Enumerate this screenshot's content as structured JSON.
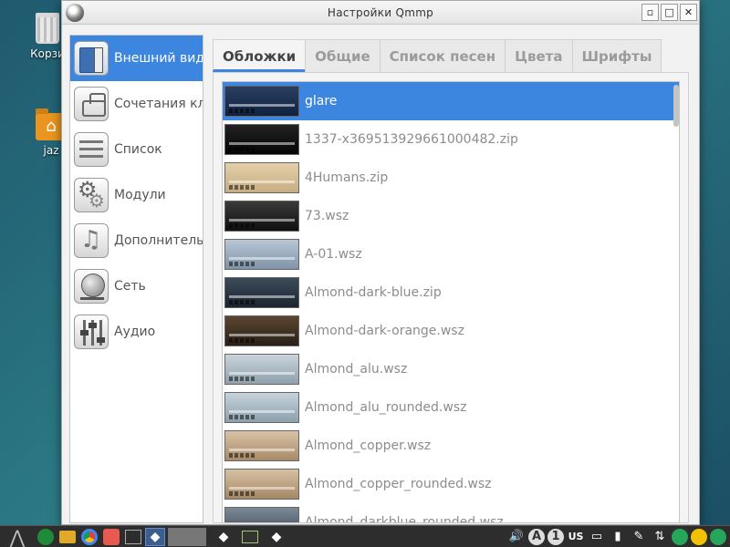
{
  "desktop": {
    "icons": [
      {
        "label": "Корзи",
        "icon": "trash-icon"
      },
      {
        "label": "jaz",
        "icon": "home-folder-icon"
      }
    ]
  },
  "window": {
    "title": "Настройки Qmmp",
    "buttons": {
      "minimize": "▫",
      "maximize": "□",
      "close": "✕"
    }
  },
  "sidebar": {
    "items": [
      {
        "label": "Внешний вид",
        "icon": "appearance-icon",
        "active": true
      },
      {
        "label": "Сочетания клавиш",
        "icon": "shortcuts-icon",
        "active": false
      },
      {
        "label": "Список",
        "icon": "playlist-icon",
        "active": false
      },
      {
        "label": "Модули",
        "icon": "plugins-icon",
        "active": false
      },
      {
        "label": "Дополнительно",
        "icon": "advanced-icon",
        "active": false
      },
      {
        "label": "Сеть",
        "icon": "network-icon",
        "active": false
      },
      {
        "label": "Аудио",
        "icon": "audio-icon",
        "active": false
      }
    ]
  },
  "tabs": [
    {
      "label": "Обложки",
      "active": true
    },
    {
      "label": "Общие",
      "active": false
    },
    {
      "label": "Список песен",
      "active": false
    },
    {
      "label": "Цвета",
      "active": false
    },
    {
      "label": "Шрифты",
      "active": false
    }
  ],
  "skins": [
    {
      "name": "glare",
      "selected": true,
      "thumb_colors": [
        "#2a3f63",
        "#112240"
      ]
    },
    {
      "name": "1337-x369513929661000482.zip",
      "selected": false,
      "thumb_colors": [
        "#222222",
        "#050505"
      ]
    },
    {
      "name": "4Humans.zip",
      "selected": false,
      "thumb_colors": [
        "#e3cfa8",
        "#c7ad82"
      ]
    },
    {
      "name": "73.wsz",
      "selected": false,
      "thumb_colors": [
        "#3a3a3a",
        "#101010"
      ]
    },
    {
      "name": "A-01.wsz",
      "selected": false,
      "thumb_colors": [
        "#b9c7d6",
        "#7f93a8"
      ]
    },
    {
      "name": "Almond-dark-blue.zip",
      "selected": false,
      "thumb_colors": [
        "#3d4c5a",
        "#1a2430"
      ]
    },
    {
      "name": "Almond-dark-orange.wsz",
      "selected": false,
      "thumb_colors": [
        "#5a4630",
        "#2a2018"
      ]
    },
    {
      "name": "Almond_alu.wsz",
      "selected": false,
      "thumb_colors": [
        "#c9d4db",
        "#8fa1ad"
      ]
    },
    {
      "name": "Almond_alu_rounded.wsz",
      "selected": false,
      "thumb_colors": [
        "#c6d3db",
        "#8ca0ad"
      ]
    },
    {
      "name": "Almond_copper.wsz",
      "selected": false,
      "thumb_colors": [
        "#d8c2a6",
        "#a88a68"
      ]
    },
    {
      "name": "Almond_copper_rounded.wsz",
      "selected": false,
      "thumb_colors": [
        "#d6c0a3",
        "#a68865"
      ]
    },
    {
      "name": "Almond_darkblue_rounded.wsz",
      "selected": false,
      "thumb_colors": [
        "#7c8a98",
        "#3b4652"
      ]
    }
  ],
  "taskbar": {
    "launchers": [
      "lxde-menu-icon",
      "terminal-icon",
      "file-manager-icon",
      "chrome-icon",
      "paint-icon",
      "show-desktop-icon"
    ],
    "tray": {
      "volume": "🔊",
      "keyboard_layout": "US",
      "badge_a": "A",
      "badge_1": "1"
    }
  },
  "colors": {
    "accent": "#3d86e0",
    "window_bg": "#f2f2f2",
    "taskbar_bg": "#2d2d2d"
  }
}
